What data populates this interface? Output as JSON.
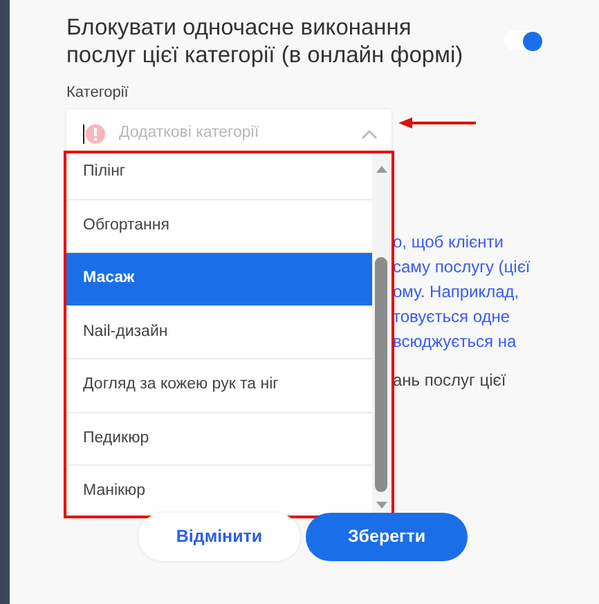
{
  "setting": {
    "title": "Блокувати одночасне виконання послуг цієї категорії (в онлайн формі)",
    "on": true
  },
  "field": {
    "label": "Категорії",
    "placeholder": "Додаткові категорії",
    "expanded": true
  },
  "options": [
    {
      "label": "Пілінг",
      "selected": false
    },
    {
      "label": "Обгортання",
      "selected": false
    },
    {
      "label": "Масаж",
      "selected": true
    },
    {
      "label": "Nail-дизайн",
      "selected": false
    },
    {
      "label": "Догляд за кожею рук та ніг",
      "selected": false
    },
    {
      "label": "Педикюр",
      "selected": false
    },
    {
      "label": "Манікюр",
      "selected": false
    }
  ],
  "background_text": [
    {
      "text": "о, щоб клієнти",
      "kind": "link"
    },
    {
      "text": "саму послугу (цієї",
      "kind": "link"
    },
    {
      "text": "ому. Наприклад,",
      "kind": "link"
    },
    {
      "text": "товується одне",
      "kind": "link"
    },
    {
      "text": "всюджується на",
      "kind": "link"
    },
    {
      "text": "ань послуг цієї",
      "kind": "plain"
    }
  ],
  "buttons": [
    {
      "label": "Відмінити",
      "kind": "secondary"
    },
    {
      "label": "Зберегти",
      "kind": "primary"
    }
  ]
}
